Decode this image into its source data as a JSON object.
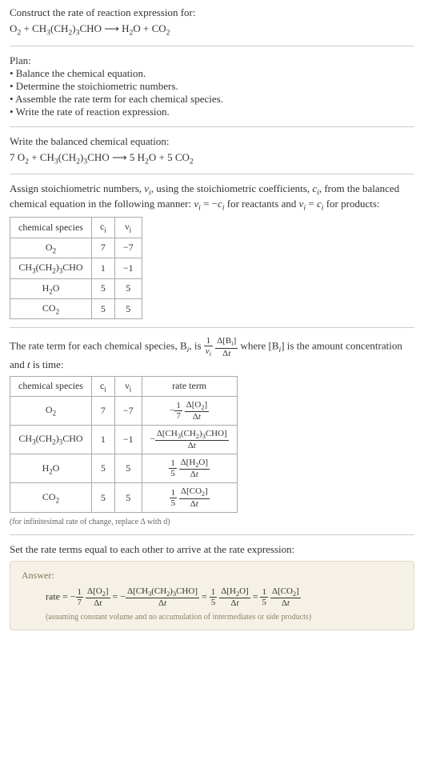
{
  "intro": {
    "prompt": "Construct the rate of reaction expression for:",
    "equation_html": "O<sub>2</sub> + CH<sub>3</sub>(CH<sub>2</sub>)<sub>3</sub>CHO ⟶ H<sub>2</sub>O + CO<sub>2</sub>"
  },
  "plan": {
    "heading": "Plan:",
    "items": [
      "• Balance the chemical equation.",
      "• Determine the stoichiometric numbers.",
      "• Assemble the rate term for each chemical species.",
      "• Write the rate of reaction expression."
    ]
  },
  "balanced": {
    "heading": "Write the balanced chemical equation:",
    "equation_html": "7 O<sub>2</sub> + CH<sub>3</sub>(CH<sub>2</sub>)<sub>3</sub>CHO ⟶ 5 H<sub>2</sub>O + 5 CO<sub>2</sub>"
  },
  "assign": {
    "text_html": "Assign stoichiometric numbers, <span class='italic'>ν<sub>i</sub></span>, using the stoichiometric coefficients, <span class='italic'>c<sub>i</sub></span>, from the balanced chemical equation in the following manner: <span class='italic'>ν<sub>i</sub></span> = −<span class='italic'>c<sub>i</sub></span> for reactants and <span class='italic'>ν<sub>i</sub></span> = <span class='italic'>c<sub>i</sub></span> for products:"
  },
  "table1": {
    "headers": {
      "species": "chemical species",
      "ci": "c<sub>i</sub>",
      "vi": "ν<sub>i</sub>"
    },
    "rows": [
      {
        "species_html": "O<sub>2</sub>",
        "ci": "7",
        "vi": "−7"
      },
      {
        "species_html": "CH<sub>3</sub>(CH<sub>2</sub>)<sub>3</sub>CHO",
        "ci": "1",
        "vi": "−1"
      },
      {
        "species_html": "H<sub>2</sub>O",
        "ci": "5",
        "vi": "5"
      },
      {
        "species_html": "CO<sub>2</sub>",
        "ci": "5",
        "vi": "5"
      }
    ]
  },
  "rate_intro": {
    "part1": "The rate term for each chemical species, B",
    "part2": ", is ",
    "frac1_num": "1",
    "frac1_den_html": "<span class='italic'>ν<sub>i</sub></span>",
    "frac2_num_html": "Δ[B<sub><span class='italic'>i</span></sub>]",
    "frac2_den_html": "Δ<span class='italic'>t</span>",
    "part3": " where [B",
    "part4": "] is the amount concentration and ",
    "part5": " is time:"
  },
  "table2": {
    "headers": {
      "species": "chemical species",
      "ci": "c<sub>i</sub>",
      "vi": "ν<sub>i</sub>",
      "rate": "rate term"
    },
    "rows": [
      {
        "species_html": "O<sub>2</sub>",
        "ci": "7",
        "vi": "−7",
        "rate_html": "−<span class='frac'><span class='num'>1</span><span class='den'>7</span></span> <span class='frac'><span class='num'>Δ[O<sub>2</sub>]</span><span class='den'>Δ<span class='italic'>t</span></span></span>"
      },
      {
        "species_html": "CH<sub>3</sub>(CH<sub>2</sub>)<sub>3</sub>CHO",
        "ci": "1",
        "vi": "−1",
        "rate_html": "−<span class='frac'><span class='num'>Δ[CH<sub>3</sub>(CH<sub>2</sub>)<sub>3</sub>CHO]</span><span class='den'>Δ<span class='italic'>t</span></span></span>"
      },
      {
        "species_html": "H<sub>2</sub>O",
        "ci": "5",
        "vi": "5",
        "rate_html": "<span class='frac'><span class='num'>1</span><span class='den'>5</span></span> <span class='frac'><span class='num'>Δ[H<sub>2</sub>O]</span><span class='den'>Δ<span class='italic'>t</span></span></span>"
      },
      {
        "species_html": "CO<sub>2</sub>",
        "ci": "5",
        "vi": "5",
        "rate_html": "<span class='frac'><span class='num'>1</span><span class='den'>5</span></span> <span class='frac'><span class='num'>Δ[CO<sub>2</sub>]</span><span class='den'>Δ<span class='italic'>t</span></span></span>"
      }
    ]
  },
  "note": "(for infinitesimal rate of change, replace Δ with d)",
  "final_heading": "Set the rate terms equal to each other to arrive at the rate expression:",
  "answer": {
    "label": "Answer:",
    "eq_html": "rate = −<span class='frac'><span class='num'>1</span><span class='den'>7</span></span> <span class='frac'><span class='num'>Δ[O<sub>2</sub>]</span><span class='den'>Δ<span class='italic'>t</span></span></span> = −<span class='frac'><span class='num'>Δ[CH<sub>3</sub>(CH<sub>2</sub>)<sub>3</sub>CHO]</span><span class='den'>Δ<span class='italic'>t</span></span></span> = <span class='frac'><span class='num'>1</span><span class='den'>5</span></span> <span class='frac'><span class='num'>Δ[H<sub>2</sub>O]</span><span class='den'>Δ<span class='italic'>t</span></span></span> = <span class='frac'><span class='num'>1</span><span class='den'>5</span></span> <span class='frac'><span class='num'>Δ[CO<sub>2</sub>]</span><span class='den'>Δ<span class='italic'>t</span></span></span>",
    "note": "(assuming constant volume and no accumulation of intermediates or side products)"
  }
}
